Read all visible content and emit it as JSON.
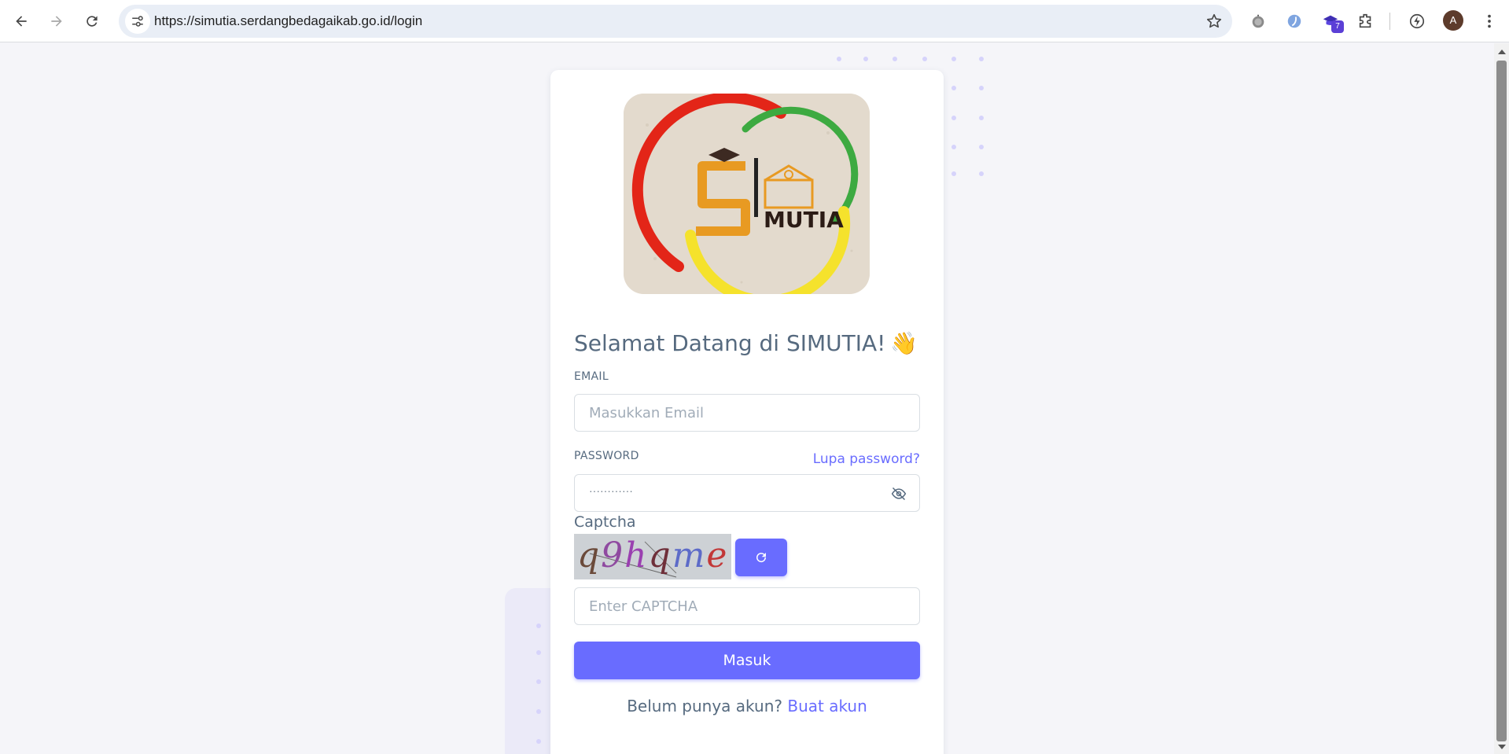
{
  "browser": {
    "url": "https://simutia.serdangbedagaikab.go.id/login",
    "profile_initial": "A",
    "extension_badge": "7"
  },
  "login": {
    "title": "Selamat Datang di SIMUTIA!",
    "title_emoji": "👋",
    "email_label": "EMAIL",
    "email_placeholder": "Masukkan Email",
    "password_label": "PASSWORD",
    "forgot_password": "Lupa password?",
    "password_mask": "············",
    "captcha_label": "Captcha",
    "captcha_text": "q9hqme",
    "captcha_placeholder": "Enter CAPTCHA",
    "submit_label": "Masuk",
    "signup_prompt": "Belum punya akun?",
    "signup_link": "Buat akun"
  },
  "logo": {
    "text": "MUTIA"
  },
  "colors": {
    "primary": "#696cff",
    "text": "#566a7f",
    "background": "#f5f5f9"
  }
}
